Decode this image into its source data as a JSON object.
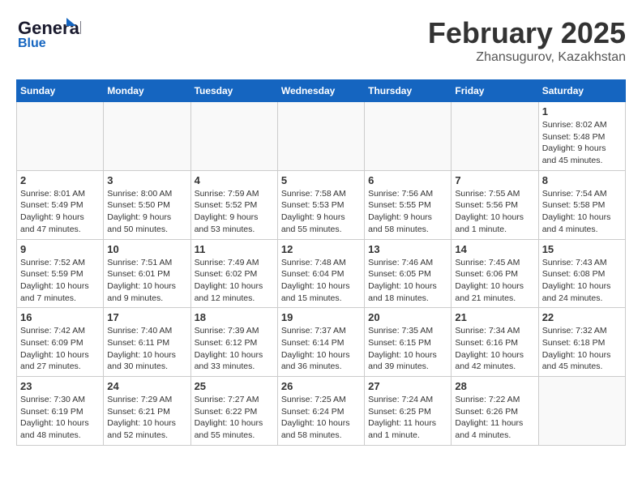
{
  "header": {
    "logo_line1": "General",
    "logo_line2": "Blue",
    "month_title": "February 2025",
    "location": "Zhansugurov, Kazakhstan"
  },
  "weekdays": [
    "Sunday",
    "Monday",
    "Tuesday",
    "Wednesday",
    "Thursday",
    "Friday",
    "Saturday"
  ],
  "weeks": [
    [
      {
        "day": "",
        "info": ""
      },
      {
        "day": "",
        "info": ""
      },
      {
        "day": "",
        "info": ""
      },
      {
        "day": "",
        "info": ""
      },
      {
        "day": "",
        "info": ""
      },
      {
        "day": "",
        "info": ""
      },
      {
        "day": "1",
        "info": "Sunrise: 8:02 AM\nSunset: 5:48 PM\nDaylight: 9 hours and 45 minutes."
      }
    ],
    [
      {
        "day": "2",
        "info": "Sunrise: 8:01 AM\nSunset: 5:49 PM\nDaylight: 9 hours and 47 minutes."
      },
      {
        "day": "3",
        "info": "Sunrise: 8:00 AM\nSunset: 5:50 PM\nDaylight: 9 hours and 50 minutes."
      },
      {
        "day": "4",
        "info": "Sunrise: 7:59 AM\nSunset: 5:52 PM\nDaylight: 9 hours and 53 minutes."
      },
      {
        "day": "5",
        "info": "Sunrise: 7:58 AM\nSunset: 5:53 PM\nDaylight: 9 hours and 55 minutes."
      },
      {
        "day": "6",
        "info": "Sunrise: 7:56 AM\nSunset: 5:55 PM\nDaylight: 9 hours and 58 minutes."
      },
      {
        "day": "7",
        "info": "Sunrise: 7:55 AM\nSunset: 5:56 PM\nDaylight: 10 hours and 1 minute."
      },
      {
        "day": "8",
        "info": "Sunrise: 7:54 AM\nSunset: 5:58 PM\nDaylight: 10 hours and 4 minutes."
      }
    ],
    [
      {
        "day": "9",
        "info": "Sunrise: 7:52 AM\nSunset: 5:59 PM\nDaylight: 10 hours and 7 minutes."
      },
      {
        "day": "10",
        "info": "Sunrise: 7:51 AM\nSunset: 6:01 PM\nDaylight: 10 hours and 9 minutes."
      },
      {
        "day": "11",
        "info": "Sunrise: 7:49 AM\nSunset: 6:02 PM\nDaylight: 10 hours and 12 minutes."
      },
      {
        "day": "12",
        "info": "Sunrise: 7:48 AM\nSunset: 6:04 PM\nDaylight: 10 hours and 15 minutes."
      },
      {
        "day": "13",
        "info": "Sunrise: 7:46 AM\nSunset: 6:05 PM\nDaylight: 10 hours and 18 minutes."
      },
      {
        "day": "14",
        "info": "Sunrise: 7:45 AM\nSunset: 6:06 PM\nDaylight: 10 hours and 21 minutes."
      },
      {
        "day": "15",
        "info": "Sunrise: 7:43 AM\nSunset: 6:08 PM\nDaylight: 10 hours and 24 minutes."
      }
    ],
    [
      {
        "day": "16",
        "info": "Sunrise: 7:42 AM\nSunset: 6:09 PM\nDaylight: 10 hours and 27 minutes."
      },
      {
        "day": "17",
        "info": "Sunrise: 7:40 AM\nSunset: 6:11 PM\nDaylight: 10 hours and 30 minutes."
      },
      {
        "day": "18",
        "info": "Sunrise: 7:39 AM\nSunset: 6:12 PM\nDaylight: 10 hours and 33 minutes."
      },
      {
        "day": "19",
        "info": "Sunrise: 7:37 AM\nSunset: 6:14 PM\nDaylight: 10 hours and 36 minutes."
      },
      {
        "day": "20",
        "info": "Sunrise: 7:35 AM\nSunset: 6:15 PM\nDaylight: 10 hours and 39 minutes."
      },
      {
        "day": "21",
        "info": "Sunrise: 7:34 AM\nSunset: 6:16 PM\nDaylight: 10 hours and 42 minutes."
      },
      {
        "day": "22",
        "info": "Sunrise: 7:32 AM\nSunset: 6:18 PM\nDaylight: 10 hours and 45 minutes."
      }
    ],
    [
      {
        "day": "23",
        "info": "Sunrise: 7:30 AM\nSunset: 6:19 PM\nDaylight: 10 hours and 48 minutes."
      },
      {
        "day": "24",
        "info": "Sunrise: 7:29 AM\nSunset: 6:21 PM\nDaylight: 10 hours and 52 minutes."
      },
      {
        "day": "25",
        "info": "Sunrise: 7:27 AM\nSunset: 6:22 PM\nDaylight: 10 hours and 55 minutes."
      },
      {
        "day": "26",
        "info": "Sunrise: 7:25 AM\nSunset: 6:24 PM\nDaylight: 10 hours and 58 minutes."
      },
      {
        "day": "27",
        "info": "Sunrise: 7:24 AM\nSunset: 6:25 PM\nDaylight: 11 hours and 1 minute."
      },
      {
        "day": "28",
        "info": "Sunrise: 7:22 AM\nSunset: 6:26 PM\nDaylight: 11 hours and 4 minutes."
      },
      {
        "day": "",
        "info": ""
      }
    ]
  ]
}
